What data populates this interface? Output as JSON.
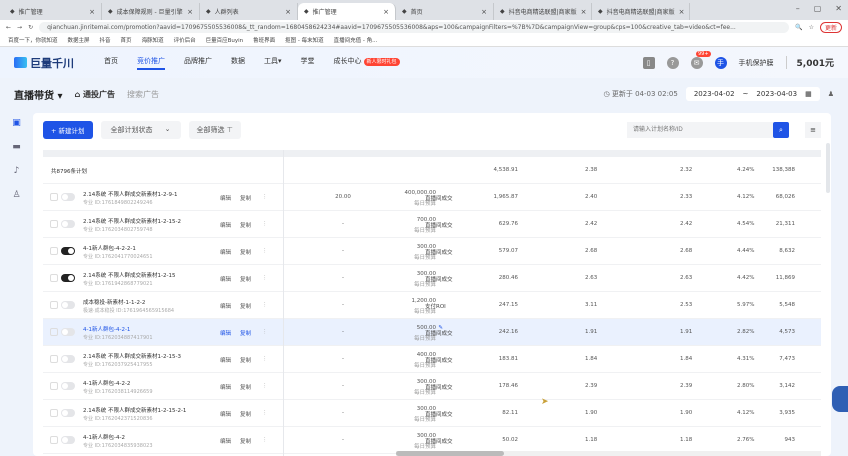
{
  "browser": {
    "tabs": [
      "推广管理",
      "成本保障规则 - 巨量引擎",
      "人群列表",
      "推广管理",
      "首页",
      "抖音电商精选联盟|商家版",
      "抖音电商精选联盟|商家版"
    ],
    "url": "qianchuan.jinritemai.com/promotion?aavid=1709675505536008&_tt_random=1680458624234#aavid=1709675505536008&aps=100&campaignFilters=%7B%7D&campaignView=group&cps=100&creative_tab=video&ct=fee...",
    "update_label": "更新",
    "bookmarks": [
      "百度一下，你就知道",
      "数据主屏",
      "抖音",
      "首页",
      "海豚知道",
      "评价后台",
      "巨量百应Buyin",
      "鲁班界面",
      "抠图 - 每末知道",
      "直播间充值 - 角..."
    ]
  },
  "header": {
    "logo": "巨量千川",
    "nav": [
      "首页",
      "竞价推广",
      "品牌推广",
      "数据",
      "工具▾",
      "学堂",
      "成长中心"
    ],
    "nav_badge": "新人限时礼包",
    "notif_count": "99+",
    "account": "手机保护膜",
    "balance": "5,001元",
    "avatar": "手"
  },
  "subheader": {
    "title": "直播带货",
    "type_active": "通投广告",
    "type_other": "搜索广告",
    "updated": "更新于 04-03 02:05",
    "date_start": "2023-04-02",
    "date_sep": "~",
    "date_end": "2023-04-03"
  },
  "toolbar": {
    "new_plan": "+ 新建计划",
    "status_filter": "全部计划状态",
    "all_filter": "全部筛选",
    "search_placeholder": "请输入计划名称/ID"
  },
  "summary": {
    "label": "共8796条计划",
    "cost": "4,538.91",
    "roi": "2.38",
    "roi2": "2.32",
    "pct": "4.24%",
    "count": "138,388"
  },
  "row_labels": {
    "edit": "编辑",
    "copy": "复制",
    "more": "⋮",
    "budget_label": "每日预算"
  },
  "rows": [
    {
      "name": "2.14系统 不限人群成交新素材1-2-9-1",
      "id": "专业  ID:1761849802249246",
      "on": false,
      "bid": "20.00",
      "budget": "400,000.00",
      "type": "直播间成交",
      "cost": "1,965.87",
      "roi": "2.40",
      "roi2": "2.33",
      "pct": "4.12%",
      "count": "68,026"
    },
    {
      "name": "2.14系统 不限人群成交新素材1-2-15-2",
      "id": "专业  ID:1762034802759748",
      "on": false,
      "bid": "-",
      "budget": "700.00",
      "type": "直播间成交",
      "cost": "629.76",
      "roi": "2.42",
      "roi2": "2.42",
      "pct": "4.54%",
      "count": "21,311"
    },
    {
      "name": "4-1新人群包-4-2-2-1",
      "id": "专业  ID:1762041770024651",
      "on": true,
      "bid": "-",
      "budget": "300.00",
      "type": "直播间成交",
      "cost": "579.07",
      "roi": "2.68",
      "roi2": "2.68",
      "pct": "4.44%",
      "count": "8,632"
    },
    {
      "name": "2.14系统 不限人群成交新素材1-2-15",
      "id": "专业  ID:1761942868779021",
      "on": true,
      "bid": "-",
      "budget": "300.00",
      "type": "直播间成交",
      "cost": "280.46",
      "roi": "2.63",
      "roi2": "2.63",
      "pct": "4.42%",
      "count": "11,869"
    },
    {
      "name": "成本稳投-新素材-1-1-2-2",
      "id": "极速·成本稳投  ID:1761964565915684",
      "on": false,
      "bid": "-",
      "budget": "1,200.00",
      "type": "支付ROI",
      "cost": "247.15",
      "roi": "3.11",
      "roi2": "2.53",
      "pct": "5.97%",
      "count": "5,548"
    },
    {
      "name": "4-1新人群包-4-2-1",
      "id": "专业  ID:1762034887417901",
      "on": false,
      "bid": "-",
      "budget": "500.00",
      "type": "直播间成交",
      "cost": "242.16",
      "roi": "1.91",
      "roi2": "1.91",
      "pct": "2.82%",
      "count": "4,573",
      "highlight": true
    },
    {
      "name": "2.14系统 不限人群成交新素材1-2-15-3",
      "id": "专业  ID:1762037925417955",
      "on": false,
      "bid": "-",
      "budget": "400.00",
      "type": "直播间成交",
      "cost": "183.81",
      "roi": "1.84",
      "roi2": "1.84",
      "pct": "4.31%",
      "count": "7,473"
    },
    {
      "name": "4-1新人群包-4-2-2",
      "id": "专业  ID:1762038114926659",
      "on": false,
      "bid": "-",
      "budget": "300.00",
      "type": "直播间成交",
      "cost": "178.46",
      "roi": "2.39",
      "roi2": "2.39",
      "pct": "2.80%",
      "count": "3,142"
    },
    {
      "name": "2.14系统 不限人群成交新素材1-2-15-2-1",
      "id": "专业  ID:1762042371520836",
      "on": false,
      "bid": "-",
      "budget": "300.00",
      "type": "直播间成交",
      "cost": "82.11",
      "roi": "1.90",
      "roi2": "1.90",
      "pct": "4.12%",
      "count": "3,935"
    },
    {
      "name": "4-1新人群包-4-2",
      "id": "专业  ID:1762034835938023",
      "on": false,
      "bid": "-",
      "budget": "300.00",
      "type": "直播间成交",
      "cost": "50.02",
      "roi": "1.18",
      "roi2": "1.18",
      "pct": "2.76%",
      "count": "943"
    }
  ]
}
